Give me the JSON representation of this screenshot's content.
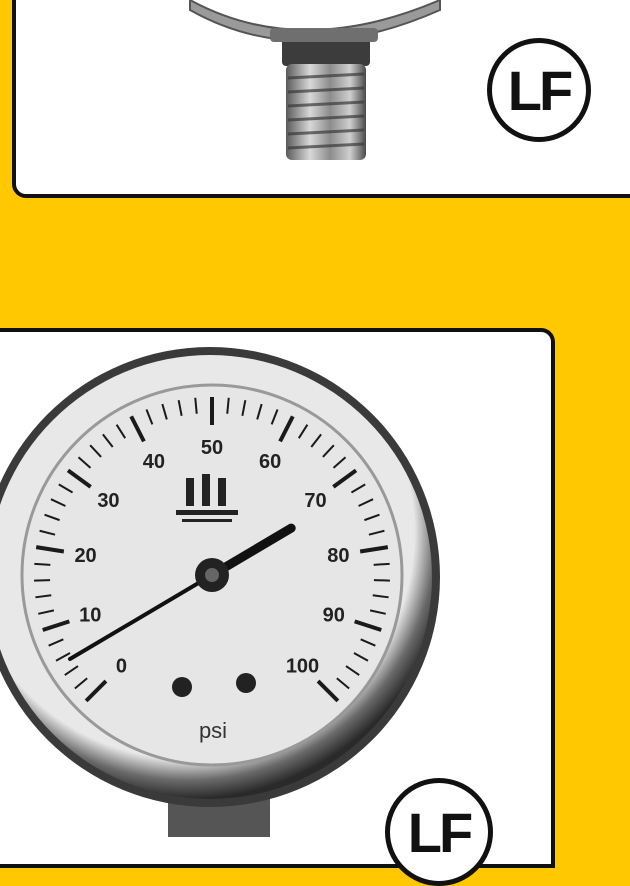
{
  "badges": {
    "top_label": "LF",
    "bottom_label": "LF"
  },
  "gauge": {
    "unit": "psi",
    "scale_min": 0,
    "scale_max": 100,
    "needle_value": 72,
    "tick_labels": [
      "0",
      "10",
      "20",
      "30",
      "40",
      "50",
      "60",
      "70",
      "80",
      "90",
      "100"
    ]
  },
  "colors": {
    "background": "#FFC800",
    "card": "#FFFFFF",
    "outline": "#111111"
  }
}
